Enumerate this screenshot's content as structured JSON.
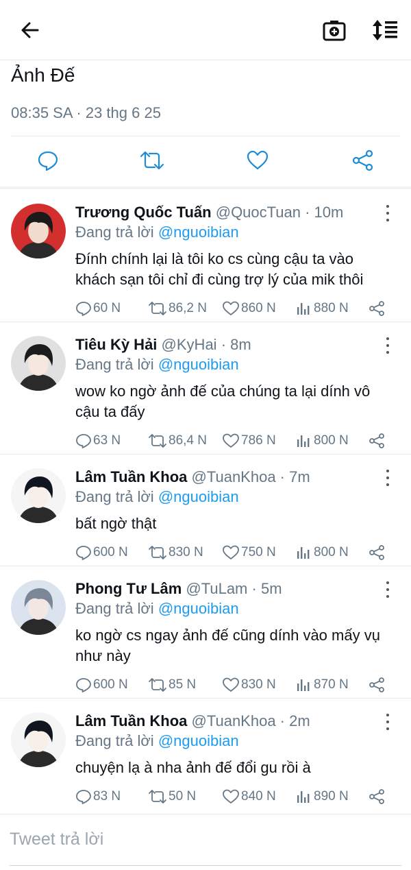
{
  "header": {
    "back_icon": "arrow-left-icon",
    "camera_icon": "camera-icon",
    "sort_icon": "sort-icon"
  },
  "main_tweet": {
    "text_tail": "Ảnh Đế",
    "timestamp": "08:35 SA · 23 thg 6 25"
  },
  "reply_input": {
    "placeholder": "Tweet trả lời"
  },
  "colors": {
    "mention": "#1d9bf0",
    "secondary": "#657786",
    "text": "#0f1419"
  },
  "replies": [
    {
      "name": "Trương Quốc Tuấn",
      "handle": "@QuocTuan",
      "time": "10m",
      "replying_prefix": "Đang trả lời",
      "replying_to": "@nguoibian",
      "text": "Đính chính lại là tôi ko cs cùng cậu ta vào khách sạn tôi chỉ đi cùng trợ lý của mik thôi",
      "replies_count": "60 N",
      "retweets": "86,2 N",
      "likes": "860 N",
      "views": "880 N"
    },
    {
      "name": "Tiêu Kỳ Hải",
      "handle": "@KyHai",
      "time": "8m",
      "replying_prefix": "Đang trả lời",
      "replying_to": "@nguoibian",
      "text": "wow ko ngờ ảnh đế của chúng ta lại dính vô cậu ta đấy",
      "replies_count": "63 N",
      "retweets": "86,4 N",
      "likes": "786 N",
      "views": "800 N"
    },
    {
      "name": "Lâm Tuần Khoa",
      "handle": "@TuanKhoa",
      "time": "7m",
      "replying_prefix": "Đang trả lời",
      "replying_to": "@nguoibian",
      "text": "bất ngờ thật",
      "replies_count": "600 N",
      "retweets": "830 N",
      "likes": "750 N",
      "views": "800 N"
    },
    {
      "name": "Phong Tư Lâm",
      "handle": "@TuLam",
      "time": "5m",
      "replying_prefix": "Đang trả lời",
      "replying_to": "@nguoibian",
      "text": "ko ngờ cs ngay ảnh đế cũng dính vào mấy vụ như này",
      "replies_count": "600 N",
      "retweets": "85 N",
      "likes": "830 N",
      "views": "870 N"
    },
    {
      "name": "Lâm Tuần Khoa",
      "handle": "@TuanKhoa",
      "time": "2m",
      "replying_prefix": "Đang trả lời",
      "replying_to": "@nguoibian",
      "text": "chuyện lạ à nha ảnh đế đổi gu rồi à",
      "replies_count": "83 N",
      "retweets": "50 N",
      "likes": "840 N",
      "views": "890 N"
    }
  ]
}
